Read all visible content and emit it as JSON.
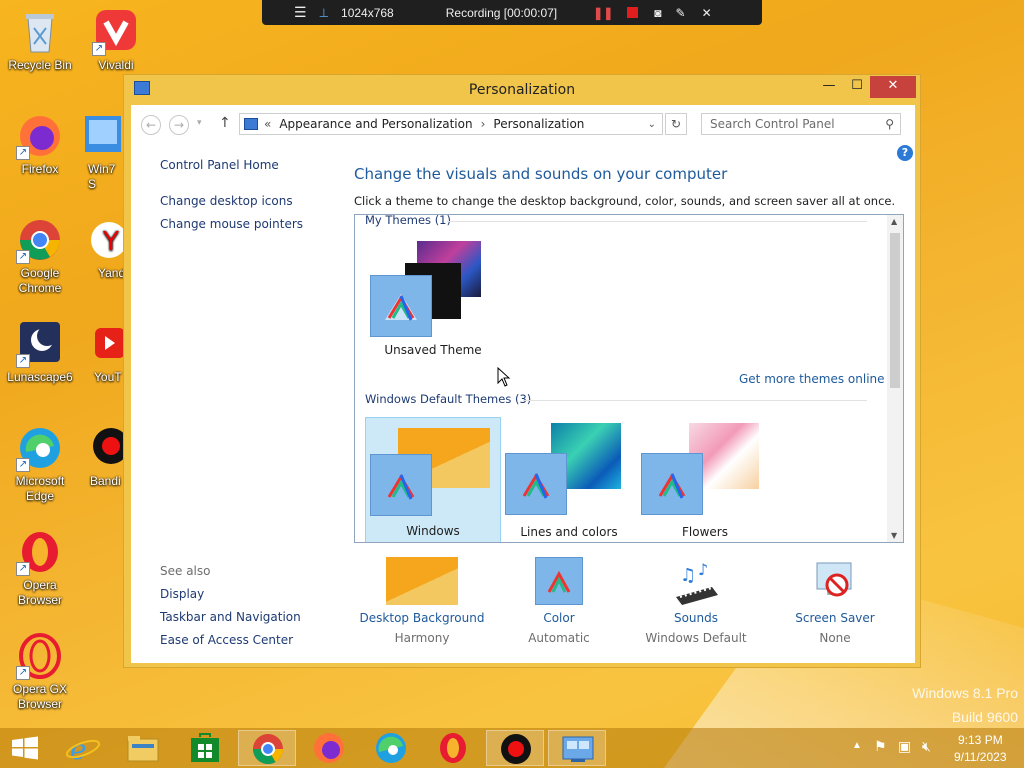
{
  "desktop": {
    "icons": [
      {
        "label": "Recycle Bin",
        "icon": "recycle-bin-icon"
      },
      {
        "label": "Vivaldi",
        "icon": "vivaldi-icon"
      },
      {
        "label": "Firefox",
        "icon": "firefox-icon"
      },
      {
        "label": "Win7 S",
        "icon": "win7-icon"
      },
      {
        "label": "Google Chrome",
        "icon": "chrome-icon"
      },
      {
        "label": "Yand",
        "icon": "yandex-icon"
      },
      {
        "label": "Lunascape6",
        "icon": "lunascape-icon"
      },
      {
        "label": "YouT",
        "icon": "youtube-icon"
      },
      {
        "label": "Microsoft Edge",
        "icon": "edge-icon"
      },
      {
        "label": "Bandi",
        "icon": "bandicam-icon"
      },
      {
        "label": "Opera Browser",
        "icon": "opera-icon"
      },
      {
        "label": "Opera GX Browser",
        "icon": "opera-gx-icon"
      }
    ],
    "watermark_line1": "Windows 8.1 Pro",
    "watermark_line2": "Build 9600"
  },
  "recorder": {
    "menu_icon": "menu-icon",
    "resolution": "1024x768",
    "status": "Recording [00:00:07]"
  },
  "window": {
    "title": "Personalization",
    "min_glyph": "—",
    "max_glyph": "☐",
    "close_glyph": "✕",
    "breadcrumb_prefix": "«",
    "breadcrumb_1": "Appearance and Personalization",
    "breadcrumb_sep": "›",
    "breadcrumb_2": "Personalization",
    "search_placeholder": "Search Control Panel",
    "help_glyph": "?",
    "sidebar": {
      "home": "Control Panel Home",
      "link1": "Change desktop icons",
      "link2": "Change mouse pointers",
      "see_also_label": "See also",
      "see1": "Display",
      "see2": "Taskbar and Navigation",
      "see3": "Ease of Access Center"
    },
    "main": {
      "title": "Change the visuals and sounds on your computer",
      "subtitle": "Click a theme to change the desktop background, color, sounds, and screen saver all at once.",
      "my_themes_header": "My Themes (1)",
      "unsaved_theme": "Unsaved Theme",
      "get_more_link": "Get more themes online",
      "default_header": "Windows Default Themes (3)",
      "theme_windows": "Windows",
      "theme_lines": "Lines and colors",
      "theme_flowers": "Flowers",
      "selected_theme": "Windows"
    },
    "bottom": {
      "bg_label": "Desktop Background",
      "bg_value": "Harmony",
      "color_label": "Color",
      "color_value": "Automatic",
      "sounds_label": "Sounds",
      "sounds_value": "Windows Default",
      "saver_label": "Screen Saver",
      "saver_value": "None"
    }
  },
  "taskbar": {
    "time": "9:13 PM",
    "date": "9/11/2023",
    "pinned": [
      "start-icon",
      "ie-icon",
      "file-explorer-icon",
      "store-icon",
      "chrome-icon",
      "firefox-icon",
      "edge-icon",
      "opera-icon",
      "bandicam-icon",
      "control-panel-icon"
    ]
  },
  "colors": {
    "accent": "#1e5a9c",
    "window_frame": "#f0c54a",
    "close_button": "#c7413d",
    "selection": "#cde8f7"
  }
}
